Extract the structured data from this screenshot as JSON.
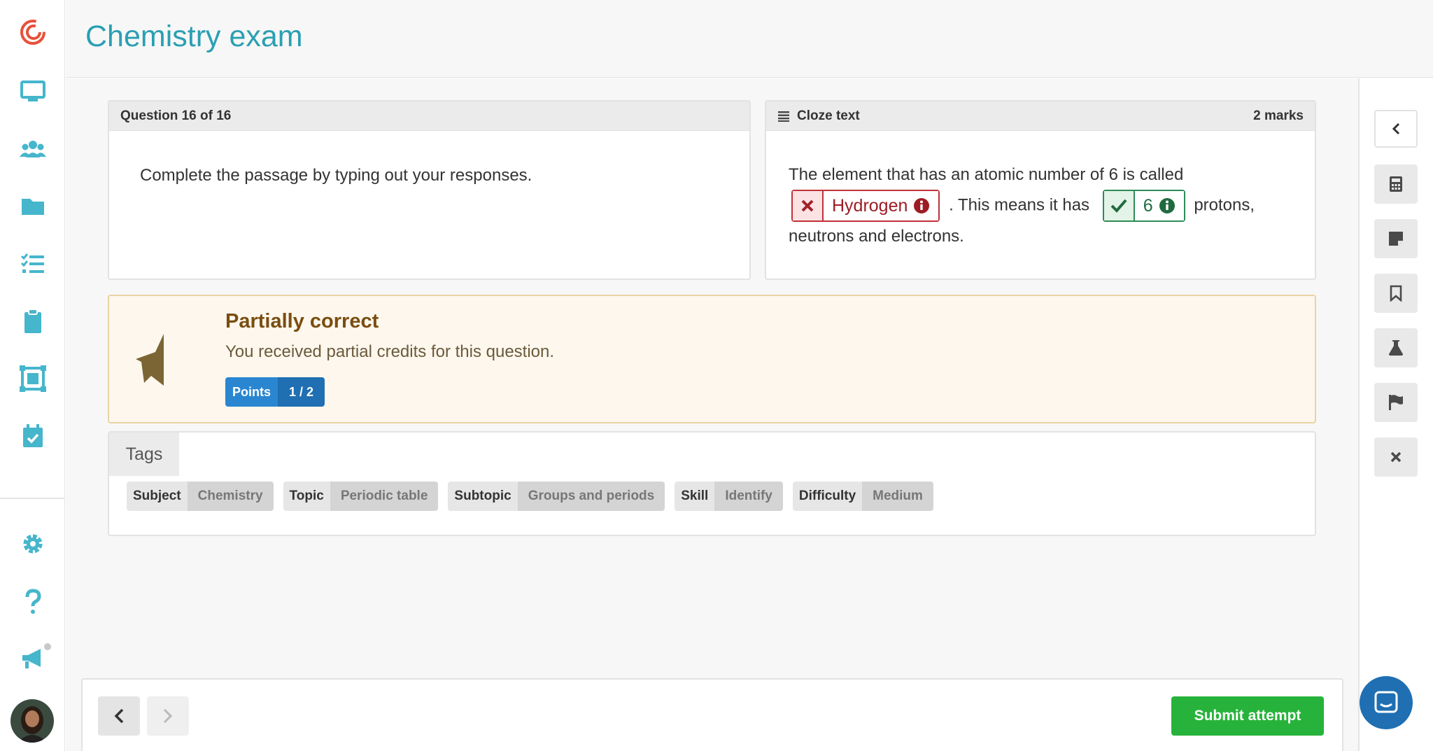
{
  "app": {
    "title": "Chemistry exam"
  },
  "question": {
    "header": "Question 16 of 16",
    "prompt": "Complete the passage by typing out your responses."
  },
  "cloze": {
    "header": "Cloze text",
    "marks": "2 marks",
    "text_before": "The element that has an atomic number of 6 is called",
    "answer1": "Hydrogen",
    "text_middle": ". This means it has",
    "answer2": "6",
    "text_after": "protons, neutrons and electrons."
  },
  "result": {
    "title": "Partially correct",
    "description": "You received partial credits for this question.",
    "points_label": "Points",
    "points_value": "1 / 2"
  },
  "tags": {
    "title": "Tags",
    "items": [
      {
        "key": "Subject",
        "value": "Chemistry"
      },
      {
        "key": "Topic",
        "value": "Periodic table"
      },
      {
        "key": "Subtopic",
        "value": "Groups and periods"
      },
      {
        "key": "Skill",
        "value": "Identify"
      },
      {
        "key": "Difficulty",
        "value": "Medium"
      }
    ]
  },
  "actions": {
    "submit_label": "Submit attempt"
  },
  "colors": {
    "accent": "#2a9fb3",
    "submit": "#27b33b",
    "wrong": "#c0313a",
    "correct": "#2e8b57",
    "points": "#2a86d1"
  },
  "icons": {
    "left_nav": [
      "logo-icon",
      "monitor-icon",
      "users-icon",
      "folder-icon",
      "checklist-icon",
      "clipboard-icon",
      "frame-icon",
      "calendar-check-icon",
      "settings-icon",
      "help-icon",
      "megaphone-icon"
    ],
    "right_tools": [
      "chevron-left-icon",
      "calculator-icon",
      "note-icon",
      "bookmark-icon",
      "flask-icon",
      "flag-icon",
      "close-icon"
    ]
  }
}
